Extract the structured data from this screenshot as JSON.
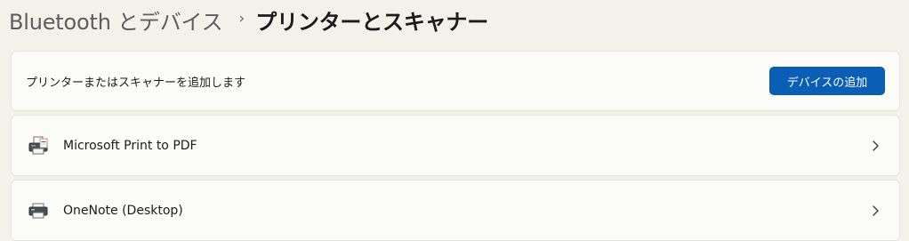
{
  "breadcrumb": {
    "parent": "Bluetooth とデバイス",
    "separator": "›",
    "current": "プリンターとスキャナー"
  },
  "add_device": {
    "label": "プリンターまたはスキャナーを追加します",
    "button_label": "デバイスの追加"
  },
  "devices": [
    {
      "name": "Microsoft Print to PDF",
      "icon": "printer-pdf-icon"
    },
    {
      "name": "OneNote (Desktop)",
      "icon": "printer-icon"
    }
  ],
  "colors": {
    "accent": "#0a5fb4",
    "background": "#f3f2ea",
    "card": "#fbfbf8"
  }
}
